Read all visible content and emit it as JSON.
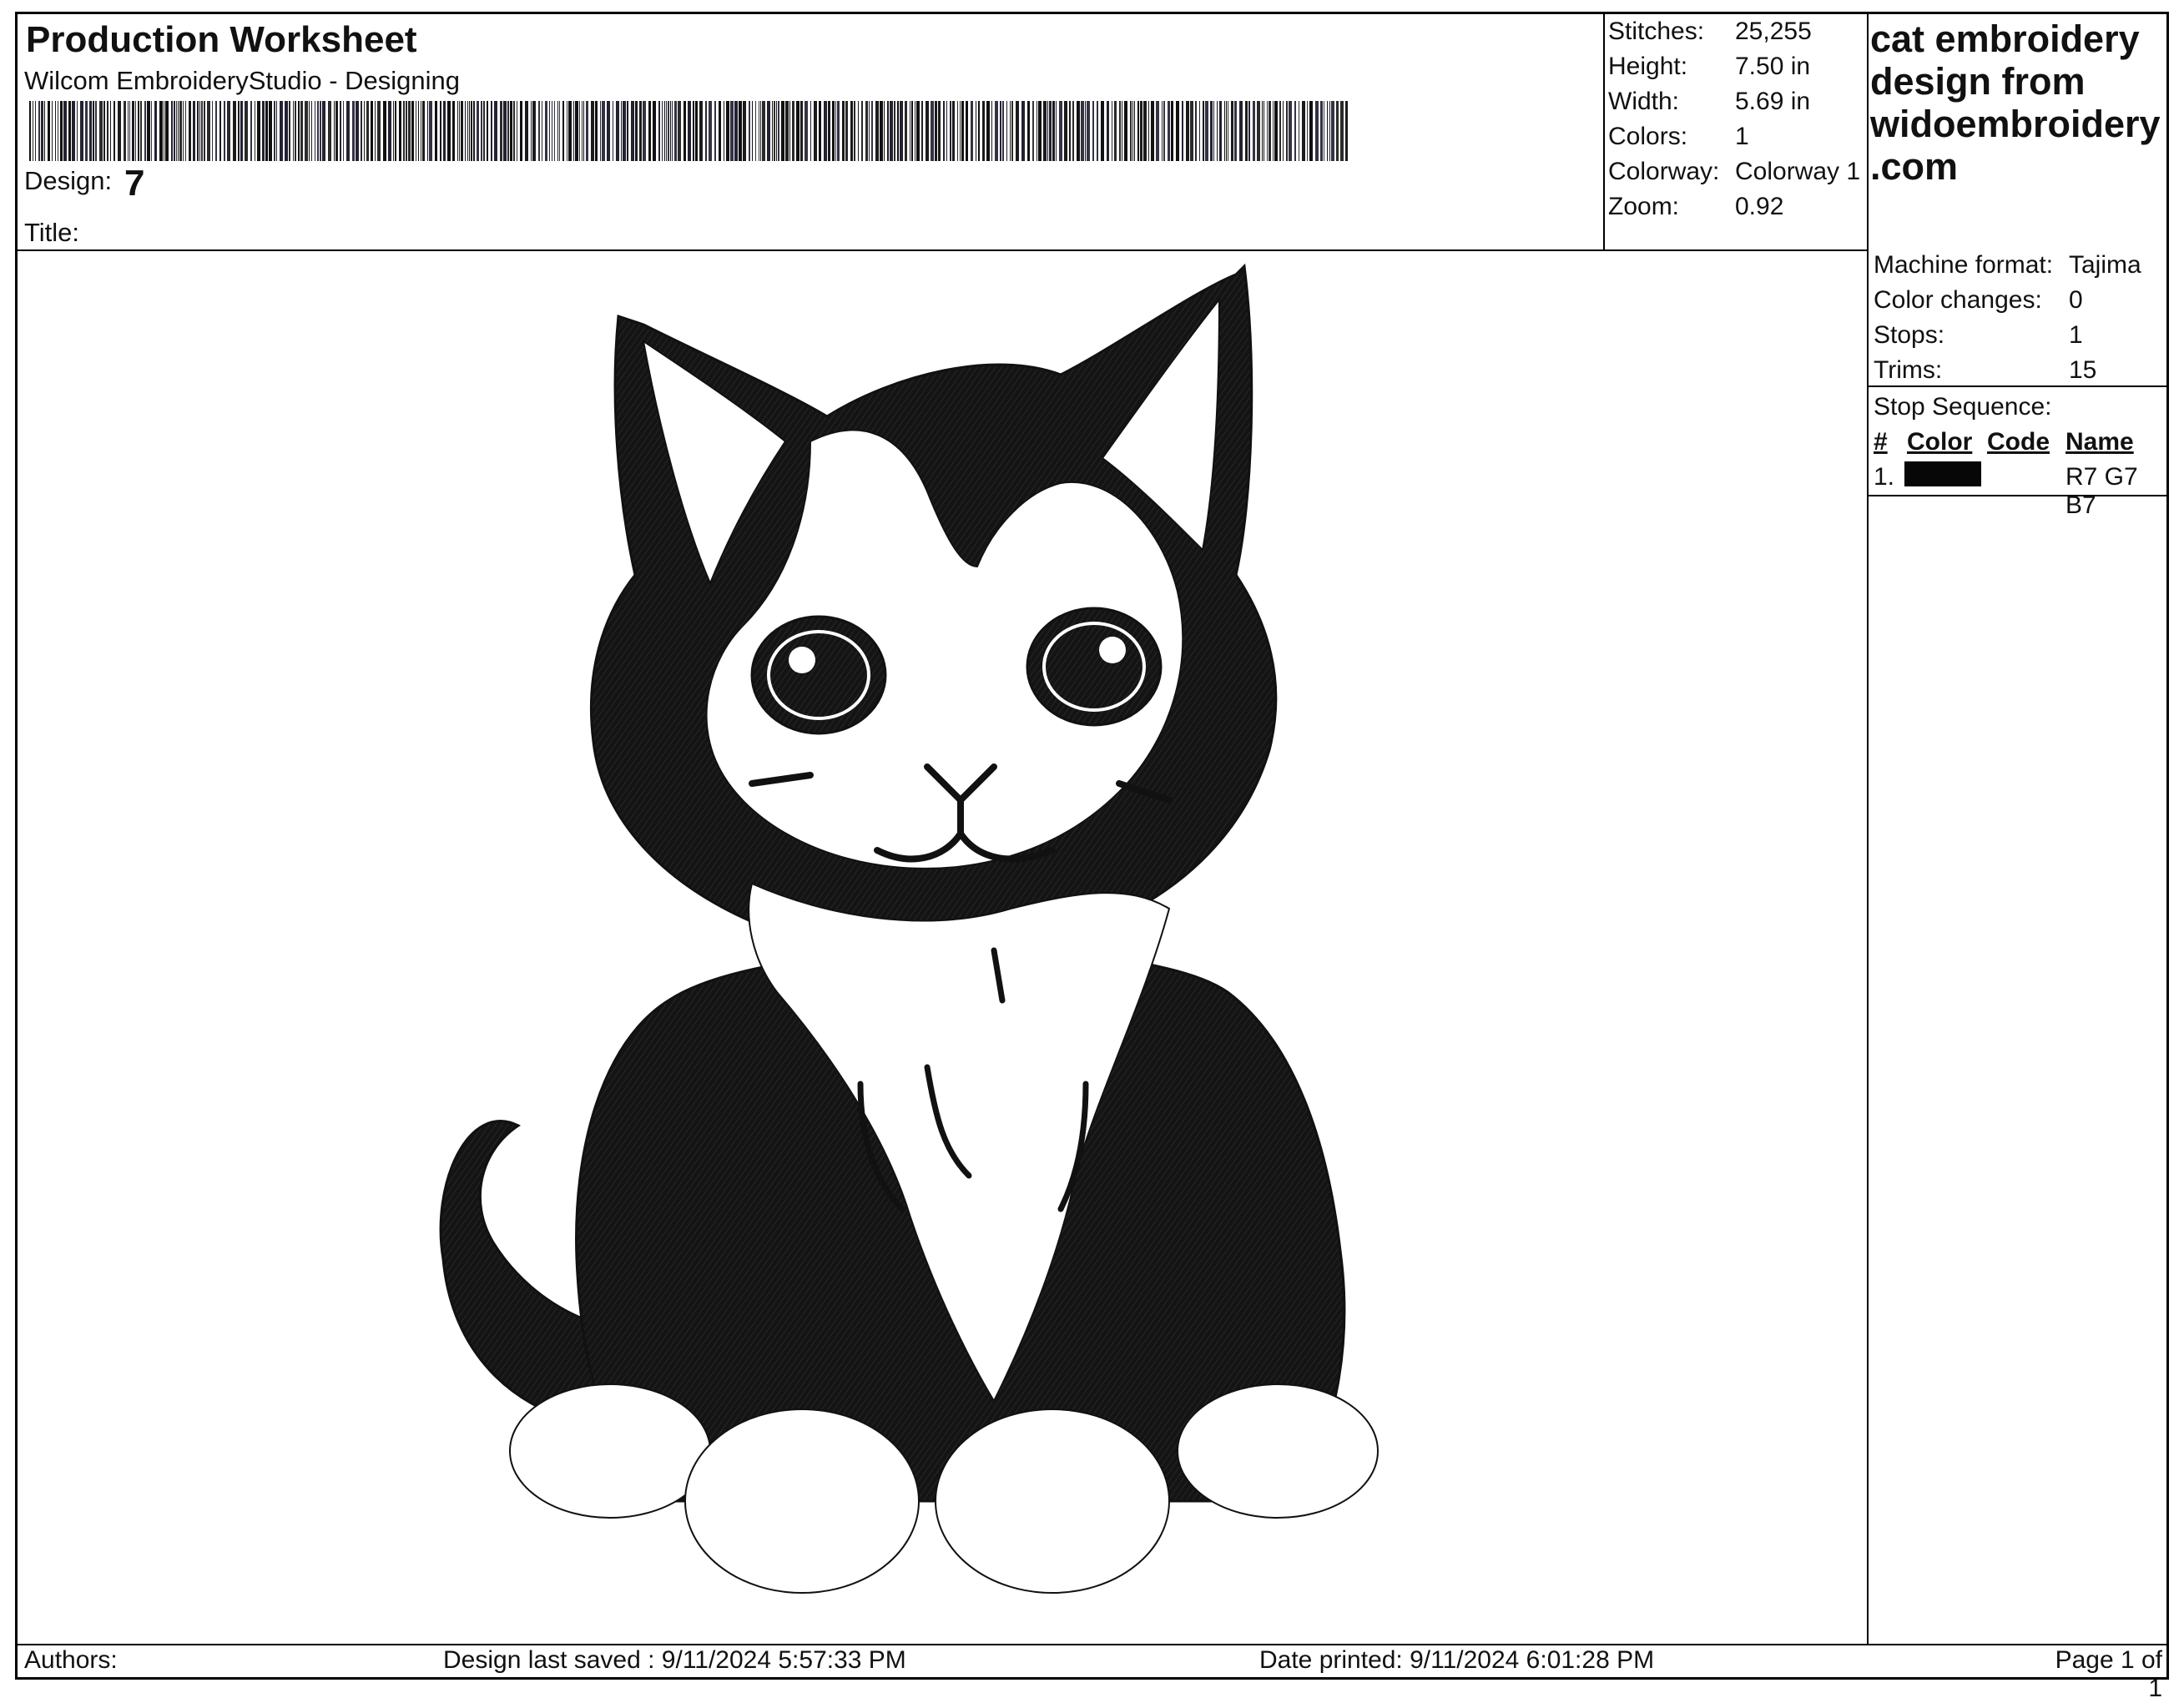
{
  "header": {
    "title": "Production Worksheet",
    "subtitle": "Wilcom EmbroideryStudio - Designing",
    "design_label": "Design:",
    "design_value": "7",
    "title_label": "Title:"
  },
  "stats": [
    {
      "label": "Stitches:",
      "value": "25,255"
    },
    {
      "label": "Height:",
      "value": "7.50 in"
    },
    {
      "label": "Width:",
      "value": "5.69 in"
    },
    {
      "label": "Colors:",
      "value": "1"
    },
    {
      "label": "Colorway:",
      "value": "Colorway 1"
    },
    {
      "label": "Zoom:",
      "value": "0.92"
    }
  ],
  "design_heading_lines": [
    "cat embroidery",
    "design from",
    "widoembroidery",
    ".com"
  ],
  "machine": [
    {
      "label": "Machine format:",
      "value": "Tajima"
    },
    {
      "label": "Color changes:",
      "value": "0"
    },
    {
      "label": "Stops:",
      "value": "1"
    },
    {
      "label": "Trims:",
      "value": "15"
    }
  ],
  "stop_sequence": {
    "label": "Stop Sequence:",
    "columns": [
      "#",
      "Color",
      "Code",
      "Name"
    ],
    "rows": [
      {
        "num": "1.",
        "swatch": "#070707",
        "code": "",
        "name": "R7 G7 B7"
      }
    ]
  },
  "footer": {
    "authors": "Authors:",
    "saved": "Design last saved : 9/11/2024 5:57:33 PM",
    "printed": "Date printed: 9/11/2024 6:01:28 PM",
    "page": "Page 1 of 1"
  },
  "colors": {
    "thread": "#111111",
    "border": "#000000",
    "background": "#ffffff"
  }
}
